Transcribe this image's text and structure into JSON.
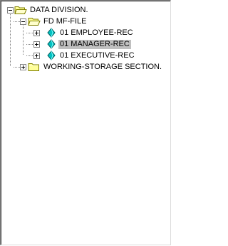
{
  "tree": {
    "nodes": [
      {
        "label": "DATA DIVISION.",
        "expander": "minus",
        "icon": "open-folder-icon",
        "level": 0
      },
      {
        "label": "FD MF-FILE",
        "expander": "minus",
        "icon": "open-folder-icon",
        "level": 1
      },
      {
        "label": "01 EMPLOYEE-REC",
        "expander": "plus",
        "icon": "record-gem-icon",
        "level": 2
      },
      {
        "label": "01 MANAGER-REC",
        "expander": "plus",
        "icon": "record-gem-icon",
        "level": 2,
        "selected": true
      },
      {
        "label": "01 EXECUTIVE-REC",
        "expander": "plus",
        "icon": "record-gem-icon",
        "level": 2
      },
      {
        "label": "WORKING-STORAGE SECTION.",
        "expander": "plus",
        "icon": "closed-folder-icon",
        "level": 1
      }
    ]
  },
  "colors": {
    "folder": "#ffff99",
    "folder_outline": "#808000",
    "gem": "#00c0c0",
    "selected_background": "#c0c0c0",
    "tree_lines": "#808080"
  }
}
